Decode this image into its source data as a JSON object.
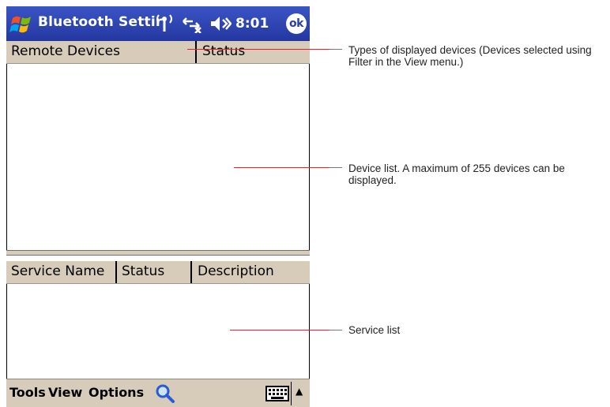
{
  "titlebar": {
    "title": "Bluetooth Settir",
    "time": "8:01",
    "ok_label": "ok",
    "icons": [
      "windows-start-icon",
      "antenna-icon",
      "connectivity-icon",
      "speaker-icon"
    ]
  },
  "devices": {
    "columns": [
      "Remote Devices",
      "Status"
    ]
  },
  "services": {
    "columns": [
      "Service Name",
      "Status",
      "Description"
    ]
  },
  "menubar": {
    "tools": "Tools",
    "view": "View",
    "options": "Options",
    "icons": [
      "search-icon",
      "keyboard-icon",
      "up-arrow-icon"
    ]
  },
  "callouts": {
    "types": "Types of displayed devices (Devices selected using Filter in the View menu.)",
    "device_list": "Device list. A maximum of 255 devices can be displayed.",
    "service_list": "Service list"
  },
  "colors": {
    "titlebar": "#2d3fa0",
    "header_bg": "#d7ccb9",
    "leader": "#e0202a"
  }
}
